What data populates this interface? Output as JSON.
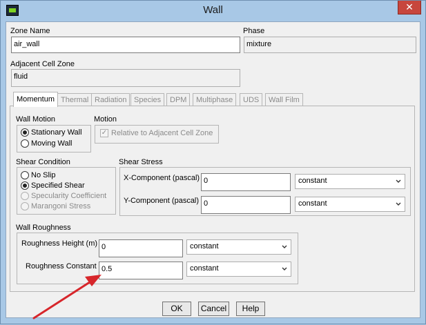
{
  "window": {
    "title": "Wall",
    "close_glyph": "✕"
  },
  "zone_name": {
    "label": "Zone Name",
    "value": "air_wall"
  },
  "phase": {
    "label": "Phase",
    "value": "mixture"
  },
  "adjacent_cell_zone": {
    "label": "Adjacent Cell Zone",
    "value": "fluid"
  },
  "tabs": [
    {
      "label": "Momentum",
      "active": true
    },
    {
      "label": "Thermal"
    },
    {
      "label": "Radiation"
    },
    {
      "label": "Species"
    },
    {
      "label": "DPM"
    },
    {
      "label": "Multiphase"
    },
    {
      "label": "UDS"
    },
    {
      "label": "Wall Film"
    }
  ],
  "wall_motion": {
    "label": "Wall Motion",
    "options": [
      "Stationary Wall",
      "Moving Wall"
    ],
    "selected": "Stationary Wall"
  },
  "motion": {
    "label": "Motion",
    "checkbox_label": "Relative to Adjacent Cell Zone",
    "checked": true
  },
  "shear_condition": {
    "label": "Shear Condition",
    "options": [
      "No Slip",
      "Specified Shear",
      "Specularity Coefficient",
      "Marangoni Stress"
    ],
    "selected": "Specified Shear"
  },
  "shear_stress": {
    "label": "Shear Stress",
    "x_label": "X-Component (pascal)",
    "x_value": "0",
    "x_method": "constant",
    "y_label": "Y-Component (pascal)",
    "y_value": "0",
    "y_method": "constant"
  },
  "wall_roughness": {
    "label": "Wall Roughness",
    "height_label": "Roughness Height (m)",
    "height_value": "0",
    "height_method": "constant",
    "constant_label": "Roughness Constant",
    "constant_value": "0.5",
    "constant_method": "constant"
  },
  "buttons": {
    "ok": "OK",
    "cancel": "Cancel",
    "help": "Help"
  },
  "colors": {
    "annotation_arrow": "#d7262b",
    "title_bar": "#a8c8e6",
    "close_button": "#c7463d"
  }
}
